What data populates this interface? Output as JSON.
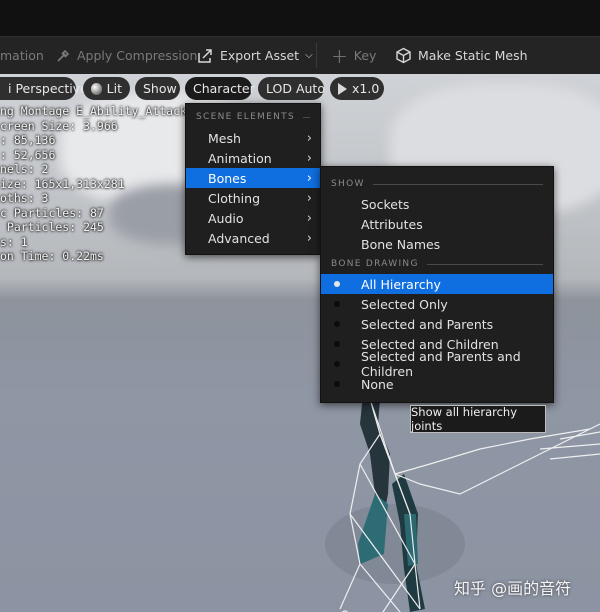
{
  "toolbar": {
    "animation_label": "mation",
    "apply_compression_label": "Apply Compression",
    "export_asset_label": "Export Asset",
    "key_label": "Key",
    "make_static_mesh_label": "Make Static Mesh"
  },
  "viewport_chips": {
    "perspective_label": "i Perspective",
    "lit_label": "Lit",
    "show_label": "Show",
    "character_label": "Character",
    "lod_label": "LOD Auto",
    "speed_label": "x1.0"
  },
  "stats": [
    "ng Montage E_Ability_Attack_A_Mo",
    "creen Size: 3.966",
    ": 85,136",
    ": 52,656",
    "nels: 2",
    "ize: 165x1,313x281",
    "oths: 3",
    "c Particles: 87",
    " Particles: 245",
    "s: 1",
    "on Time: 0.22ms"
  ],
  "character_menu": {
    "header": "SCENE ELEMENTS",
    "items": [
      {
        "label": "Mesh"
      },
      {
        "label": "Animation"
      },
      {
        "label": "Bones"
      },
      {
        "label": "Clothing"
      },
      {
        "label": "Audio"
      },
      {
        "label": "Advanced"
      }
    ],
    "selected_index": 2
  },
  "bones_menu": {
    "show_header": "SHOW",
    "show_items": [
      {
        "label": "Sockets"
      },
      {
        "label": "Attributes"
      },
      {
        "label": "Bone Names"
      }
    ],
    "drawing_header": "BONE DRAWING",
    "drawing_items": [
      {
        "label": "All Hierarchy"
      },
      {
        "label": "Selected Only"
      },
      {
        "label": "Selected and Parents"
      },
      {
        "label": "Selected and Children"
      },
      {
        "label": "Selected and Parents and Children"
      },
      {
        "label": "None"
      }
    ],
    "selected_index": 0
  },
  "tooltip": "Show all hierarchy joints",
  "watermark": "知乎 @画的音符",
  "colors": {
    "accent": "#0f6fe0",
    "menu_bg": "#1f1f1f",
    "toolbar_bg": "#242424"
  }
}
